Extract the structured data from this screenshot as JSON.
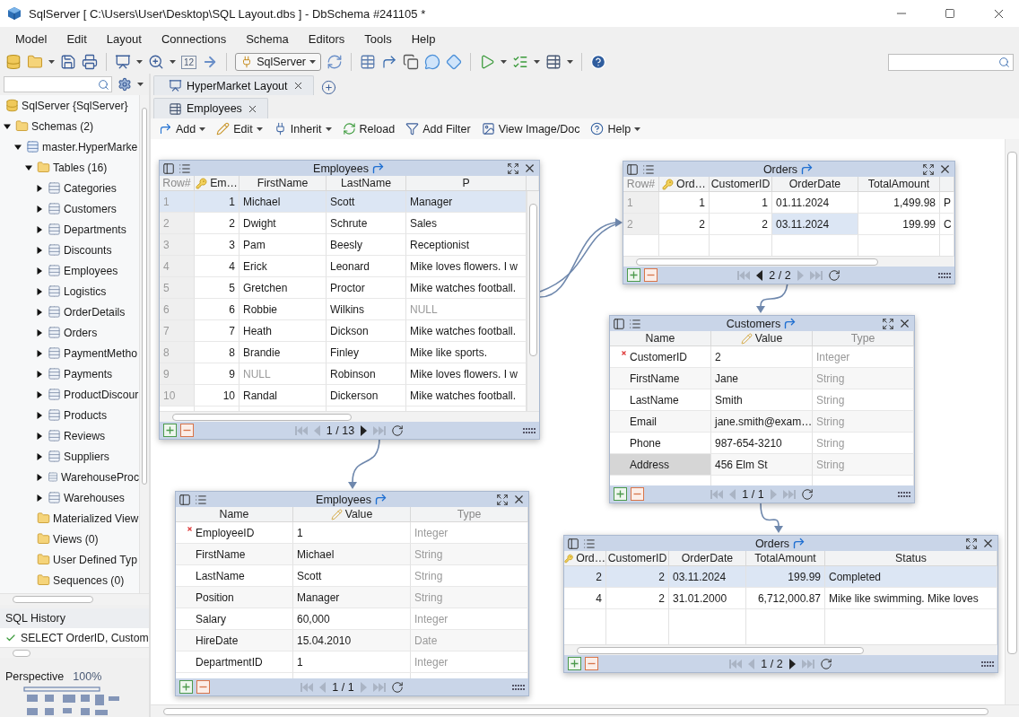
{
  "window": {
    "title": "SqlServer [ C:\\Users\\User\\Desktop\\SQL Layout.dbs ] - DbSchema #241105 *"
  },
  "menu": [
    "Model",
    "Edit",
    "Layout",
    "Connections",
    "Schema",
    "Editors",
    "Tools",
    "Help"
  ],
  "toolbar": {
    "zoom_box": "12",
    "connection": "SqlServer"
  },
  "sidebar": {
    "tree": [
      {
        "label": "SqlServer {SqlServer}",
        "kind": "database",
        "children": [
          {
            "label": "Schemas (2)",
            "kind": "folder",
            "expanded": true,
            "children": [
              {
                "label": "master.HyperMarke",
                "kind": "schema",
                "expanded": true,
                "children": [
                  {
                    "label": "Tables (16)",
                    "kind": "folder",
                    "expanded": true,
                    "children": [
                      {
                        "label": "Categories",
                        "kind": "table",
                        "expanded": false
                      },
                      {
                        "label": "Customers",
                        "kind": "table",
                        "expanded": false
                      },
                      {
                        "label": "Departments",
                        "kind": "table",
                        "expanded": false
                      },
                      {
                        "label": "Discounts",
                        "kind": "table",
                        "expanded": false
                      },
                      {
                        "label": "Employees",
                        "kind": "table",
                        "expanded": false
                      },
                      {
                        "label": "Logistics",
                        "kind": "table",
                        "expanded": false
                      },
                      {
                        "label": "OrderDetails",
                        "kind": "table",
                        "expanded": false
                      },
                      {
                        "label": "Orders",
                        "kind": "table",
                        "expanded": false
                      },
                      {
                        "label": "PaymentMetho",
                        "kind": "table",
                        "expanded": false
                      },
                      {
                        "label": "Payments",
                        "kind": "table",
                        "expanded": false
                      },
                      {
                        "label": "ProductDiscour",
                        "kind": "table",
                        "expanded": false
                      },
                      {
                        "label": "Products",
                        "kind": "table",
                        "expanded": false
                      },
                      {
                        "label": "Reviews",
                        "kind": "table",
                        "expanded": false
                      },
                      {
                        "label": "Suppliers",
                        "kind": "table",
                        "expanded": false
                      },
                      {
                        "label": "WarehouseProc",
                        "kind": "table",
                        "expanded": false
                      },
                      {
                        "label": "Warehouses",
                        "kind": "table",
                        "expanded": false
                      }
                    ]
                  },
                  {
                    "label": "Materialized View",
                    "kind": "folder"
                  },
                  {
                    "label": "Views (0)",
                    "kind": "folder"
                  },
                  {
                    "label": "User Defined Typ",
                    "kind": "folder"
                  },
                  {
                    "label": "Sequences (0)",
                    "kind": "folder"
                  }
                ]
              }
            ]
          }
        ]
      }
    ],
    "history": {
      "title": "SQL History",
      "items": [
        {
          "text": "SELECT OrderID, Custom"
        }
      ]
    },
    "perspective": {
      "label": "Perspective",
      "zoom": "100%"
    }
  },
  "tabs": [
    {
      "label": "HyperMarket Layout",
      "selected": true
    }
  ],
  "subtabs": [
    {
      "label": "Employees",
      "selected": true
    }
  ],
  "actions": [
    {
      "label": "Add",
      "has_menu": true
    },
    {
      "label": "Edit",
      "has_menu": true
    },
    {
      "label": "Inherit",
      "has_menu": true
    },
    {
      "label": "Reload",
      "has_menu": false
    },
    {
      "label": "Add Filter",
      "has_menu": false
    },
    {
      "label": "View Image/Doc",
      "has_menu": false
    },
    {
      "label": "Help",
      "has_menu": true
    }
  ],
  "panels": [
    {
      "kind": "grid",
      "title": "Employees",
      "columns": [
        {
          "label": "Row#",
          "kind": "row_number"
        },
        {
          "label": "Em…",
          "kind": "key"
        },
        {
          "label": "FirstName",
          "kind": "text"
        },
        {
          "label": "LastName",
          "kind": "text"
        },
        {
          "label": "P",
          "kind": "text"
        }
      ],
      "rows": [
        {
          "cells": [
            "1",
            "1",
            "Michael",
            "Scott",
            "Manager"
          ],
          "selected": true
        },
        {
          "cells": [
            "2",
            "2",
            "Dwight",
            "Schrute",
            "Sales"
          ],
          "selected": false
        },
        {
          "cells": [
            "3",
            "3",
            "Pam",
            "Beesly",
            "Receptionist"
          ],
          "selected": false
        },
        {
          "cells": [
            "4",
            "4",
            "Erick",
            "Leonard",
            "Mike loves flowers. I w"
          ],
          "selected": false
        },
        {
          "cells": [
            "5",
            "5",
            "Gretchen",
            "Proctor",
            "Mike watches football."
          ],
          "selected": false
        },
        {
          "cells": [
            "6",
            "6",
            "Robbie",
            "Wilkins",
            {
              "text": "NULL",
              "null": true
            }
          ],
          "selected": false
        },
        {
          "cells": [
            "7",
            "7",
            "Heath",
            "Dickson",
            "Mike watches football."
          ],
          "selected": false
        },
        {
          "cells": [
            "8",
            "8",
            "Brandie",
            "Finley",
            "Mike like sports."
          ],
          "selected": false
        },
        {
          "cells": [
            "9",
            "9",
            {
              "text": "NULL",
              "null": true
            },
            "Robinson",
            "Mike loves flowers. I w"
          ],
          "selected": false
        },
        {
          "cells": [
            "10",
            "10",
            "Randal",
            "Dickerson",
            "Mike watches football."
          ],
          "selected": false
        }
      ],
      "pager": {
        "text": "1 / 13",
        "prev_enabled": false,
        "next_enabled": true
      }
    },
    {
      "kind": "grid",
      "title": "Orders",
      "columns": [
        {
          "label": "Row#",
          "kind": "row_number",
          "focused": false
        },
        {
          "label": "Ord…",
          "kind": "key",
          "focused": false
        },
        {
          "label": "CustomerID",
          "kind": "number",
          "focused": false
        },
        {
          "label": "OrderDate",
          "kind": "text",
          "focused": true
        },
        {
          "label": "TotalAmount",
          "kind": "number",
          "focused": false
        },
        {
          "kind": "text",
          "focused": false
        }
      ],
      "rows": [
        {
          "cells": [
            "1",
            "1",
            "1",
            "01.11.2024",
            "1,499.98",
            "P"
          ],
          "selected": false
        },
        {
          "cells": [
            "2",
            "2",
            "2",
            "03.11.2024",
            "199.99",
            "C"
          ],
          "selected": true
        }
      ],
      "pager": {
        "text": "2 / 2",
        "prev_enabled": true,
        "next_enabled": false
      }
    },
    {
      "kind": "record",
      "title": "Customers",
      "columns": [
        {
          "label": "Name",
          "kind": "name"
        },
        {
          "label": "Value",
          "kind": "value"
        },
        {
          "label": "Type",
          "kind": "type"
        }
      ],
      "rows": [
        {
          "name": "CustomerID",
          "value": "2",
          "type": "Integer",
          "primary_key": true,
          "selected": false
        },
        {
          "name": "FirstName",
          "value": "Jane",
          "type": "String",
          "primary_key": false,
          "selected": false
        },
        {
          "name": "LastName",
          "value": "Smith",
          "type": "String",
          "primary_key": false,
          "selected": false
        },
        {
          "name": "Email",
          "value": "jane.smith@exam…",
          "type": "String",
          "primary_key": false,
          "selected": false
        },
        {
          "name": "Phone",
          "value": "987-654-3210",
          "type": "String",
          "primary_key": false,
          "selected": false
        },
        {
          "name": "Address",
          "value": "456 Elm St",
          "type": "String",
          "primary_key": false,
          "selected": true
        }
      ],
      "pager": {
        "text": "1 / 1",
        "prev_enabled": false,
        "next_enabled": false
      }
    },
    {
      "kind": "record",
      "title": "Employees",
      "columns": [
        {
          "label": "Name",
          "kind": "name"
        },
        {
          "label": "Value",
          "kind": "value"
        },
        {
          "label": "Type",
          "kind": "type"
        }
      ],
      "rows": [
        {
          "name": "EmployeeID",
          "value": "1",
          "type": "Integer",
          "primary_key": true,
          "selected": false
        },
        {
          "name": "FirstName",
          "value": "Michael",
          "type": "String",
          "primary_key": false,
          "selected": false
        },
        {
          "name": "LastName",
          "value": "Scott",
          "type": "String",
          "primary_key": false,
          "selected": false
        },
        {
          "name": "Position",
          "value": "Manager",
          "type": "String",
          "primary_key": false,
          "selected": false
        },
        {
          "name": "Salary",
          "value": "60,000",
          "type": "Integer",
          "primary_key": false,
          "selected": false
        },
        {
          "name": "HireDate",
          "value": "15.04.2010",
          "type": "Date",
          "primary_key": false,
          "selected": false
        },
        {
          "name": "DepartmentID",
          "value": "1",
          "type": "Integer",
          "primary_key": false,
          "selected": false
        }
      ],
      "pager": {
        "text": "1 / 1",
        "prev_enabled": false,
        "next_enabled": false
      }
    },
    {
      "kind": "grid",
      "title": "Orders",
      "columns": [
        {
          "label": "Ord…",
          "kind": "key"
        },
        {
          "label": "CustomerID",
          "kind": "number"
        },
        {
          "label": "OrderDate",
          "kind": "text"
        },
        {
          "label": "TotalAmount",
          "kind": "number"
        },
        {
          "label": "Status",
          "kind": "text"
        }
      ],
      "rows": [
        {
          "cells": [
            "2",
            "2",
            "03.11.2024",
            "199.99",
            "Completed"
          ],
          "selected": true
        },
        {
          "cells": [
            "4",
            "2",
            "31.01.2000",
            "6,712,000.87",
            "Mike like swimming. Mike loves"
          ],
          "selected": false
        }
      ],
      "pager": {
        "text": "1 / 2",
        "prev_enabled": false,
        "next_enabled": true
      }
    }
  ]
}
